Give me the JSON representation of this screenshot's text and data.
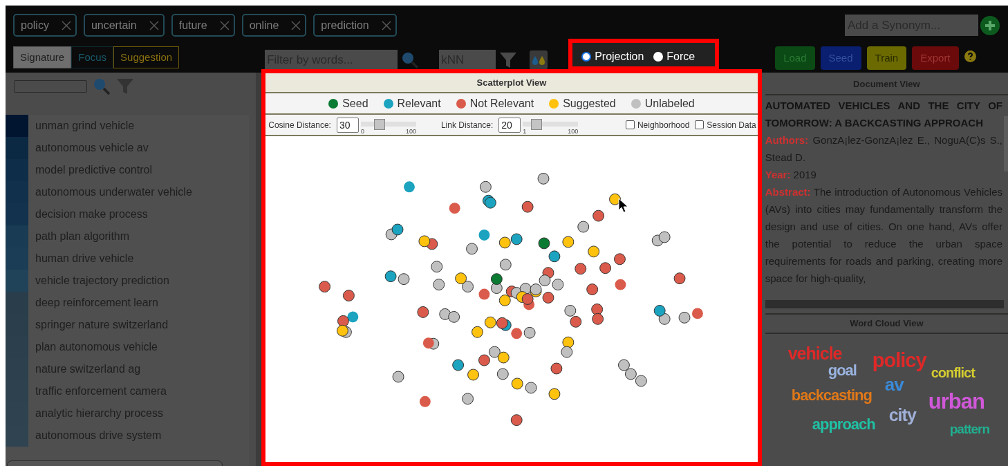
{
  "tags": [
    {
      "label": "policy"
    },
    {
      "label": "uncertain"
    },
    {
      "label": "future"
    },
    {
      "label": "online"
    },
    {
      "label": "prediction"
    }
  ],
  "modes": [
    {
      "label": "Signature",
      "kind": "signature",
      "selected": true
    },
    {
      "label": "Focus",
      "kind": "focus",
      "selected": false
    },
    {
      "label": "Suggestion",
      "kind": "suggestion",
      "selected": false
    }
  ],
  "filter": {
    "placeholder": "Filter by words..."
  },
  "knn": {
    "placeholder": "kNN"
  },
  "layout_options": [
    {
      "label": "Projection",
      "selected": true
    },
    {
      "label": "Force",
      "selected": false
    }
  ],
  "synonym": {
    "placeholder": "Add a Synonym..."
  },
  "actions": [
    {
      "label": "Load",
      "kind": "load"
    },
    {
      "label": "Seed",
      "kind": "seed"
    },
    {
      "label": "Train",
      "kind": "train"
    },
    {
      "label": "Export",
      "kind": "export"
    }
  ],
  "phrases": [
    {
      "text": "unman grind vehicle",
      "color": "#021530"
    },
    {
      "text": "autonomous vehicle av",
      "color": "#0c2944"
    },
    {
      "text": "model predictive control",
      "color": "#0e2d48"
    },
    {
      "text": "autonomous underwater vehicle",
      "color": "#10304c"
    },
    {
      "text": "decision make process",
      "color": "#12324e"
    },
    {
      "text": "path plan algorithm",
      "color": "#193b53"
    },
    {
      "text": "human drive vehicle",
      "color": "#1b3d55"
    },
    {
      "text": "vehicle trajectory prediction",
      "color": "#20435a"
    },
    {
      "text": "deep reinforcement learn",
      "color": "#293d4b"
    },
    {
      "text": "springer nature switzerland",
      "color": "#2a3e4c"
    },
    {
      "text": "plan autonomous vehicle",
      "color": "#2b3f4d"
    },
    {
      "text": "nature switzerland ag",
      "color": "#2c404e"
    },
    {
      "text": "traffic enforcement camera",
      "color": "#2d414f"
    },
    {
      "text": "analytic hierarchy process",
      "color": "#2e4250"
    },
    {
      "text": "autonomous drive system",
      "color": "#2f4351"
    }
  ],
  "scatter": {
    "title": "Scatterplot View",
    "legend": [
      {
        "label": "Seed",
        "color": "#0b7a33"
      },
      {
        "label": "Relevant",
        "color": "#1ba3bf"
      },
      {
        "label": "Not Relevant",
        "color": "#da5b4b"
      },
      {
        "label": "Suggested",
        "color": "#ffc20f"
      },
      {
        "label": "Unlabeled",
        "color": "#c0c0c0"
      }
    ],
    "sliders": [
      {
        "label": "Cosine Distance:",
        "value": "30",
        "min": "0",
        "max": "100",
        "level": 0.3
      },
      {
        "label": "Link Distance:",
        "value": "20",
        "min": "1",
        "max": "100",
        "level": 0.19
      }
    ],
    "checkboxes": [
      {
        "label": "Neighborhood",
        "checked": false
      },
      {
        "label": "Session Data",
        "checked": false
      }
    ]
  },
  "document": {
    "title": "Document View",
    "heading": "AUTOMATED VEHICLES AND THE CITY OF TOMORROW: A BACKCASTING APPROACH",
    "fields": [
      {
        "label": "Authors:",
        "value": "GonzA¡lez-GonzA¡lez E., NoguA(C)s S., Stead D."
      },
      {
        "label": "Year:",
        "value": "2019"
      },
      {
        "label": "Abstract:",
        "value": "The introduction of Autonomous Vehicles (AVs) into cities may fundamentally transform the design and use of cities. On one hand, AVs offer the potential to reduce the urban space requirements for roads and parking, creating more space for high-quality,"
      }
    ]
  },
  "word_cloud": {
    "title": "Word Cloud View",
    "words": [
      {
        "text": "vehicle",
        "color": "#e02828"
      },
      {
        "text": "policy",
        "color": "#e02828"
      },
      {
        "text": "goal",
        "color": "#9ab4e0"
      },
      {
        "text": "conflict",
        "color": "#d4cc30"
      },
      {
        "text": "av",
        "color": "#3a8ad8"
      },
      {
        "text": "backcasting",
        "color": "#e07818"
      },
      {
        "text": "urban",
        "color": "#d058d8"
      },
      {
        "text": "city",
        "color": "#a0b0d8"
      },
      {
        "text": "approach",
        "color": "#20c0a4"
      },
      {
        "text": "pattern",
        "color": "#20b090"
      }
    ]
  }
}
